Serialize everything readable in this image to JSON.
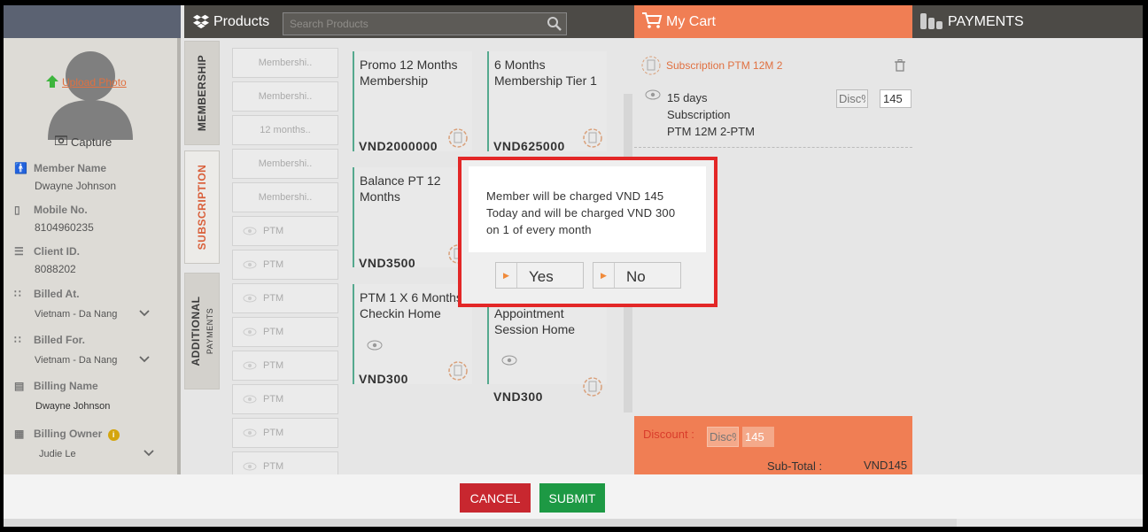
{
  "header": {
    "products_title": "Products",
    "search_placeholder": "Search Products",
    "cart_title": "My Cart",
    "payments_title": "PAYMENTS"
  },
  "member": {
    "upload_label": "Upload Photo",
    "capture_label": "Capture",
    "name_label": "Member Name",
    "name_value": "Dwayne Johnson",
    "mobile_label": "Mobile No.",
    "mobile_value": "8104960235",
    "client_label": "Client ID.",
    "client_value": "8088202",
    "billed_at_label": "Billed At.",
    "billed_at_value": "Vietnam - Da Nang",
    "billed_for_label": "Billed For.",
    "billed_for_value": "Vietnam - Da Nang",
    "billing_name_label": "Billing Name",
    "billing_name_value": "Dwayne  Johnson",
    "billing_owner_label": "Billing Owner",
    "billing_owner_value": "Judie Le"
  },
  "tabs": {
    "membership": "MEMBERSHIP",
    "subscription": "SUBSCRIPTION",
    "additional": "ADDITIONAL",
    "payments": "PAYMENTS"
  },
  "product_list": [
    "Membershi..",
    "Membershi..",
    "12 months..",
    "Membershi..",
    "Membershi..",
    "PTM",
    "PTM",
    "PTM",
    "PTM",
    "PTM",
    "PTM",
    "PTM",
    "PTM"
  ],
  "cards": [
    {
      "title": "Promo 12 Months Membership",
      "price": "VND2000000"
    },
    {
      "title": "6 Months Membership Tier 1",
      "price": "VND625000"
    },
    {
      "title": "Balance PT 12 Months",
      "price": "VND3500"
    },
    {
      "title": "PTM 1 X 6 Months Checkin Home",
      "price": "VND300"
    },
    {
      "title": "PTM 1 X 6 Months Appointment Session Home",
      "price": "VND300"
    }
  ],
  "cart": {
    "item_title": "Subscription PTM 12M 2",
    "desc_line1": "15 days",
    "desc_line2": "Subscription",
    "desc_line3": "PTM 12M 2-PTM",
    "disc_placeholder": "Disc%",
    "qty_value": "145",
    "discount_label": "Discount :",
    "discount_placeholder": "Disc%",
    "discount_value": "145",
    "subtotal_label": "Sub-Total  :",
    "subtotal_value": "VND145"
  },
  "footer": {
    "cancel": "CANCEL",
    "submit": "SUBMIT"
  },
  "modal": {
    "message": "Member will be charged VND 145 Today and will be charged VND 300 on 1 of every month",
    "yes": "Yes",
    "no": "No"
  },
  "colors": {
    "accent": "#f07e54",
    "topbar": "#4c4a46",
    "cancel": "#c8272f",
    "submit": "#1d9944",
    "highlight_border": "#e32727"
  }
}
